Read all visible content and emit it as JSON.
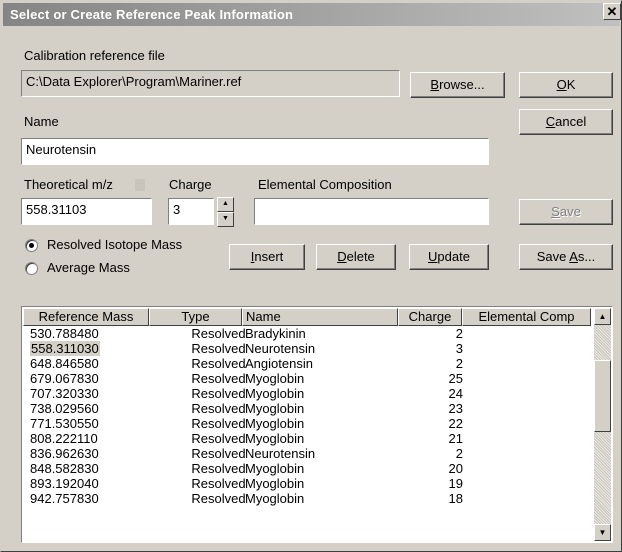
{
  "title": "Select or Create Reference Peak Information",
  "close_glyph": "✕",
  "calibration": {
    "label": "Calibration reference file",
    "path": "C:\\Data Explorer\\Program\\Mariner.ref"
  },
  "buttons": {
    "browse_u": "B",
    "browse_rest": "rowse...",
    "ok_u": "O",
    "ok_rest": "K",
    "cancel_u": "C",
    "cancel_rest": "ancel",
    "save_u": "S",
    "save_rest": "ave",
    "insert_u": "I",
    "insert_rest": "nsert",
    "delete_u": "D",
    "delete_rest": "elete",
    "update_u": "U",
    "update_rest": "pdate",
    "saveas_pre": "Save ",
    "saveas_u": "A",
    "saveas_rest": "s..."
  },
  "name": {
    "label": "Name",
    "value": "Neurotensin"
  },
  "theoretical": {
    "label": "Theoretical m/z",
    "value": "558.31103"
  },
  "charge": {
    "label": "Charge",
    "value": "3"
  },
  "elemental": {
    "label": "Elemental Composition",
    "value": ""
  },
  "mass_mode": {
    "options": [
      "Resolved Isotope Mass",
      "Average Mass"
    ],
    "selected": "Resolved Isotope Mass"
  },
  "table": {
    "columns": [
      "Reference Mass",
      "Type",
      "Name",
      "Charge",
      "Elemental Comp"
    ],
    "selected_row": 1,
    "rows": [
      [
        "530.788480",
        "Resolved",
        "Bradykinin",
        "2",
        ""
      ],
      [
        "558.311030",
        "Resolved",
        "Neurotensin",
        "3",
        ""
      ],
      [
        "648.846580",
        "Resolved",
        "Angiotensin",
        "2",
        ""
      ],
      [
        "679.067830",
        "Resolved",
        "Myoglobin",
        "25",
        ""
      ],
      [
        "707.320330",
        "Resolved",
        "Myoglobin",
        "24",
        ""
      ],
      [
        "738.029560",
        "Resolved",
        "Myoglobin",
        "23",
        ""
      ],
      [
        "771.530550",
        "Resolved",
        "Myoglobin",
        "22",
        ""
      ],
      [
        "808.222110",
        "Resolved",
        "Myoglobin",
        "21",
        ""
      ],
      [
        "836.962630",
        "Resolved",
        "Neurotensin",
        "2",
        ""
      ],
      [
        "848.582830",
        "Resolved",
        "Myoglobin",
        "20",
        ""
      ],
      [
        "893.192040",
        "Resolved",
        "Myoglobin",
        "19",
        ""
      ],
      [
        "942.757830",
        "Resolved",
        "Myoglobin",
        "18",
        ""
      ]
    ]
  },
  "icons": {
    "scroll_up": "scroll-up-arrow-icon",
    "scroll_down": "scroll-down-arrow-icon",
    "spin_up": "spin-up-icon",
    "spin_down": "spin-down-icon"
  }
}
